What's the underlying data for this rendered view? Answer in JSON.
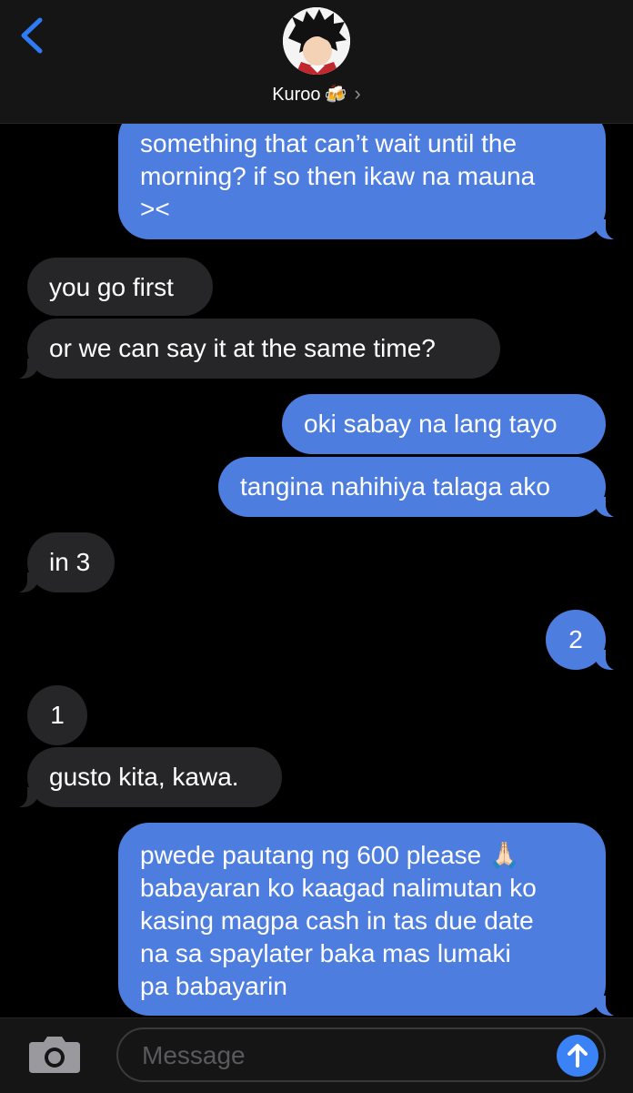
{
  "header": {
    "contact_name": "Kuroo",
    "contact_emoji": "🍻",
    "chevron": "›",
    "icons": {
      "back": "chevron-left-icon",
      "avatar": "avatar"
    },
    "accent_color": "#2f7bf6"
  },
  "messages": [
    {
      "direction": "sent",
      "text": "something that can’t wait until the\nmorning? if so then ikaw na mauna\n><"
    },
    {
      "direction": "received",
      "text": "you go first"
    },
    {
      "direction": "received",
      "text": "or we can say it at the same time?"
    },
    {
      "direction": "sent",
      "text": "oki sabay na lang tayo"
    },
    {
      "direction": "sent",
      "text": "tangina nahihiya talaga ako"
    },
    {
      "direction": "received",
      "text": "in 3"
    },
    {
      "direction": "sent",
      "text": "2"
    },
    {
      "direction": "received",
      "text": "1"
    },
    {
      "direction": "received",
      "text": "gusto kita, kawa."
    },
    {
      "direction": "sent",
      "text": "pwede pautang ng 600 please 🙏🏻\nbabayaran ko kaagad nalimutan ko\nkasing magpa cash in tas due date\nna sa spaylater baka mas lumaki\npa babayarin"
    }
  ],
  "compose": {
    "placeholder": "Message",
    "icons": {
      "camera": "camera-icon",
      "send": "send-arrow-icon"
    }
  },
  "colors": {
    "sent_bubble": "#4e7de0",
    "received_bubble": "#262628",
    "background": "#000000"
  }
}
